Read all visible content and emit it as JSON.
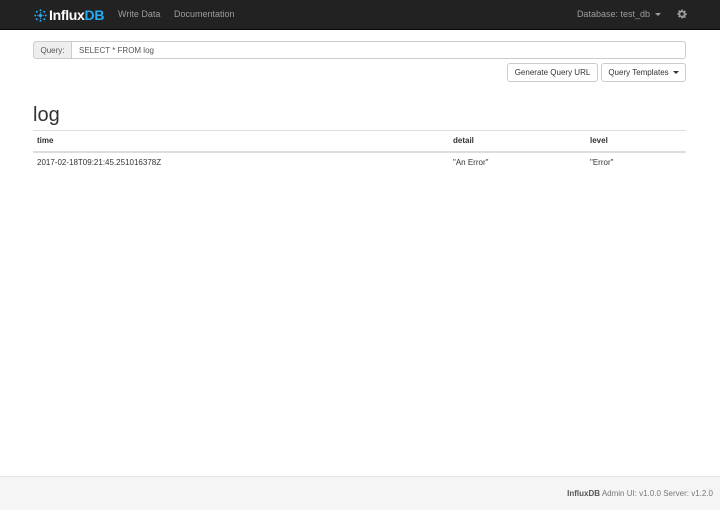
{
  "navbar": {
    "brand_main": "Influx",
    "brand_accent": "DB",
    "links": [
      {
        "label": "Write Data"
      },
      {
        "label": "Documentation"
      }
    ],
    "database_label": "Database: test_db",
    "settings_icon": "gear-icon"
  },
  "query": {
    "label": "Query:",
    "value": "SELECT * FROM log"
  },
  "buttons": {
    "generate_url": "Generate Query URL",
    "templates": "Query Templates"
  },
  "result": {
    "title": "log",
    "columns": [
      "time",
      "detail",
      "level"
    ],
    "rows": [
      [
        "2017-02-18T09:21:45.251016378Z",
        "\"An Error\"",
        "\"Error\""
      ]
    ]
  },
  "footer": {
    "brand": "InfluxDB",
    "version_text": "Admin UI: v1.0.0 Server: v1.2.0"
  },
  "colors": {
    "navbar_bg": "#222222",
    "brand_accent": "#22adf6",
    "footer_bg": "#f5f5f5"
  }
}
